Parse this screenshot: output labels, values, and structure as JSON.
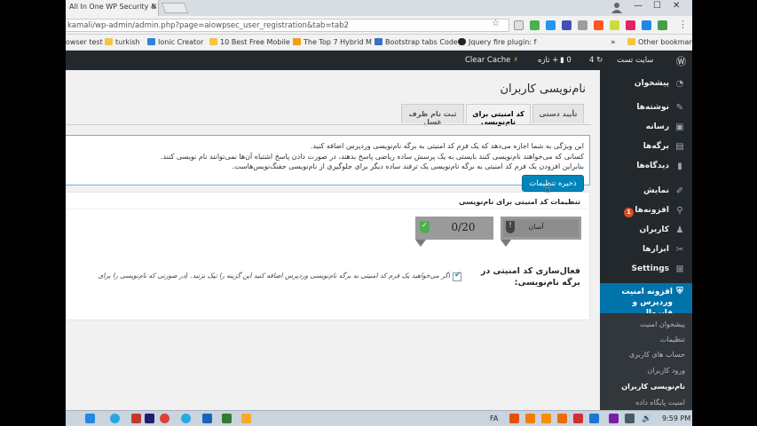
{
  "browser": {
    "tab_title": "All In One WP Security &",
    "url": "kamali/wp-admin/admin.php?page=aiowpsec_user_registration&tab=tab2",
    "bookmarks": [
      "owser test",
      "turkish",
      "Ionic Creator",
      "10 Best Free Mobile",
      "The Top 7 Hybrid M",
      "Bootstrap tabs Code",
      "Jquery fire plugin: f"
    ],
    "other_bookmarks": "Other bookmark"
  },
  "adminbar": {
    "site_name": "سایت تست",
    "updates": "4",
    "comments": "0",
    "new": "تازه",
    "clear_cache": "Clear Cache"
  },
  "sidebar": {
    "items": [
      {
        "label": "پیشخوان",
        "icon": "dashboard-icon"
      },
      {
        "label": "نوشته‌ها",
        "icon": "pin-icon"
      },
      {
        "label": "رسانه",
        "icon": "media-icon"
      },
      {
        "label": "برگه‌ها",
        "icon": "page-icon"
      },
      {
        "label": "دیدگاه‌ها",
        "icon": "comment-icon"
      },
      {
        "label": "نمایش",
        "icon": "brush-icon"
      },
      {
        "label": "افزونه‌ها",
        "icon": "plugin-icon",
        "badge": "1"
      },
      {
        "label": "کاربران",
        "icon": "user-icon"
      },
      {
        "label": "ابزارها",
        "icon": "wrench-icon"
      },
      {
        "label": "Settings",
        "icon": "settings-icon"
      }
    ],
    "active": "افزونه امنیت وردپرس و فایروال",
    "submenu": [
      "پیشخوان امنیت",
      "تنظیمات",
      "حساب های کاربری",
      "ورود کاربران",
      "نام‌نویسی کاربران",
      "امنیت پایگاه داده"
    ]
  },
  "main": {
    "title": "نام‌نویسی کاربران",
    "tabs": [
      "تأیید دستی",
      "کد امنیتی برای نام‌نویسی",
      "ثبت نام ظرف عسل"
    ],
    "info_lines": [
      "این ویژگی به شما اجازه می‌دهد که یک فرم کد امنیتی به برگه نام‌نویسی وردپرس اضافه کنید.",
      "کسانی که می‌خواهند نام‌نویسی کنند بایستی به یک پرسش ساده ریاضی پاسخ بدهند، در صورت دادن پاسخ اشتباه آن‌ها نمی‌توانند نام نویسی کنند.",
      "بنابراین افزودن یک فرم کد امنیتی به برگه نام‌نویسی یک ترفند ساده دیگر برای جلوگیری از نام‌نویسی جفنگ‌نویس‌هاست."
    ],
    "box_title": "تنظیمات کد امنیتی برای نام‌نویسی",
    "difficulty": "آسان",
    "score": "0/20",
    "setting_label": "فعال‌سازی کد امنیتی در برگه نام‌نویسی:",
    "checkbox_desc": "اگر می‌خواهید یک فرم کد امنیتی به برگه نام‌نویسی وردپرس اضافه کنید این گزینه را تیک بزنید. (در صورتی که نام‌نویسی را برای",
    "save_label": "ذخیره تنظیمات"
  },
  "taskbar": {
    "lang": "FA",
    "time": "9:59 PM"
  }
}
